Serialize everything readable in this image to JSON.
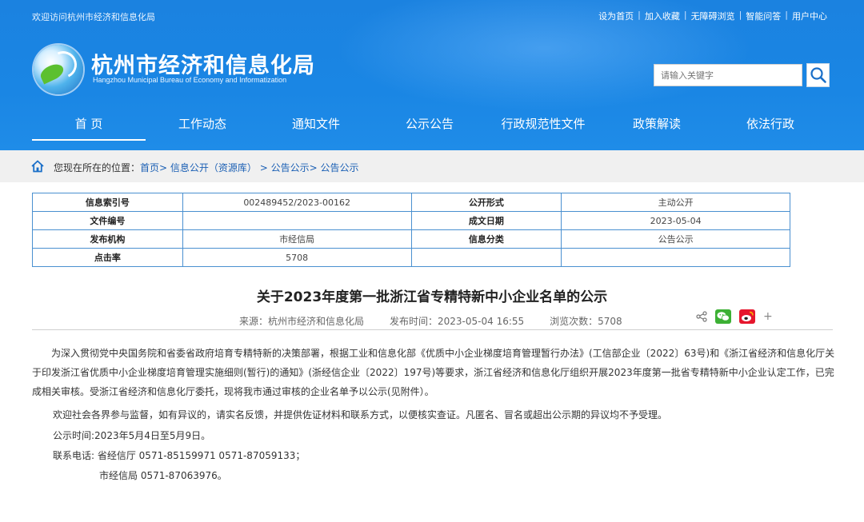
{
  "header": {
    "welcome": "欢迎访问杭州市经济和信息化局",
    "top_links": [
      "设为首页",
      "加入收藏",
      "无障碍浏览",
      "智能问答",
      "用户中心"
    ],
    "top_link_separator": "|",
    "site_title": "杭州市经济和信息化局",
    "site_subtitle": "Hangzhou Municipal Bureau of Economy and Informatization",
    "search_placeholder": "请输入关键字",
    "nav": [
      "首 页",
      "工作动态",
      "通知文件",
      "公示公告",
      "行政规范性文件",
      "政策解读",
      "依法行政"
    ],
    "nav_active_index": 0
  },
  "breadcrumb": {
    "prefix": "您现在所在的位置：",
    "items": [
      "首页",
      "信息公开（资源库）",
      "公告公示",
      "公告公示"
    ],
    "separators": [
      "> ",
      " > ",
      "> "
    ]
  },
  "info_table": {
    "rows": [
      [
        "信息索引号",
        "002489452/2023-00162",
        "公开形式",
        "主动公开"
      ],
      [
        "文件编号",
        "",
        "成文日期",
        "2023-05-04"
      ],
      [
        "发布机构",
        "市经信局",
        "信息分类",
        "公告公示"
      ],
      [
        "点击率",
        "5708",
        "",
        ""
      ]
    ]
  },
  "article": {
    "title": "关于2023年度第一批浙江省专精特新中小企业名单的公示",
    "source": "来源：杭州市经济和信息化局",
    "publish_time": "发布时间：2023-05-04 16:55",
    "views": "浏览次数：5708",
    "share_more": "+",
    "paragraph1": "为深入贯彻党中央国务院和省委省政府培育专精特新的决策部署，根据工业和信息化部《优质中小企业梯度培育管理暂行办法》(工信部企业〔2022〕63号)和《浙江省经济和信息化厅关于印发浙江省优质中小企业梯度培育管理实施细则(暂行)的通知》(浙经信企业〔2022〕197号)等要求，浙江省经济和信息化厅组织开展2023年度第一批省专精特新中小企业认定工作，已完成相关审核。受浙江省经济和信息化厅委托，现将我市通过审核的企业名单予以公示(见附件）。",
    "paragraph2": "欢迎社会各界参与监督，如有异议的，请实名反馈，并提供佐证材料和联系方式，以便核实查证。凡匿名、冒名或超出公示期的异议均不予受理。",
    "paragraph3": "公示时间:2023年5月4日至5月9日。",
    "contact1": "联系电话: 省经信厅 0571-85159971 0571-87059133；",
    "contact2": "市经信局 0571-87063976。"
  },
  "colors": {
    "header_blue": "#1a86e4",
    "link_blue": "#1a5fb4",
    "table_border": "#4a90d0",
    "wechat_green": "#3cb034",
    "weibo_red": "#e6162d"
  },
  "icons": [
    "home-icon",
    "search-icon",
    "share-icon",
    "wechat-icon",
    "weibo-icon",
    "plus-icon"
  ]
}
